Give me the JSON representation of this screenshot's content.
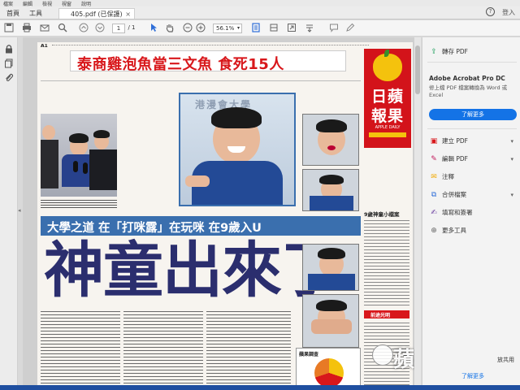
{
  "menu": {
    "items": [
      "檔案",
      "編輯",
      "檢視",
      "視窗",
      "說明"
    ]
  },
  "tabs": {
    "home": "首頁",
    "tools": "工具",
    "document": "405.pdf (已保護)",
    "close_glyph": "×"
  },
  "window_controls": {
    "help": "?",
    "sign_in": "登入"
  },
  "toolbar": {
    "page_current": "1",
    "page_total": "/ 1",
    "zoom": "56.1%"
  },
  "right_pane": {
    "export_pdf": "轉存 PDF",
    "promo_title": "Adobe Acrobat Pro DC",
    "promo_desc": "修上檔 PDF 檔案轉換為 Word 或 Excel",
    "promo_button": "了解更多",
    "create_pdf": "建立 PDF",
    "edit_pdf": "編輯 PDF",
    "comment": "注釋",
    "combine": "合併檔案",
    "fill_sign": "填寫和簽署",
    "more_tools": "更多工具",
    "bottom_link": "了解更多",
    "bottom_partial": "放共用"
  },
  "newspaper": {
    "page_label": "A1",
    "top_headline": "泰商雞泡魚當三文魚 食死15人",
    "masthead_line1": "日蘋",
    "masthead_line2": "報果",
    "masthead_sub": "APPLE DAILY",
    "banner": "大學之道 在「打咪露」在玩咪 在9歲入U",
    "main_headline": "神童出來了",
    "photo_caption_top": "港漫會大學",
    "sidebar_title": "9歲神童小檔案",
    "sidebar_box": "前途光明",
    "poll_title": "蘋果調查",
    "watermark": "蘋果日報"
  },
  "colors": {
    "accent_blue": "#1473e6",
    "headline_red": "#d8171b",
    "banner_blue": "#3a6fae",
    "masthead_red": "#d3131a"
  }
}
